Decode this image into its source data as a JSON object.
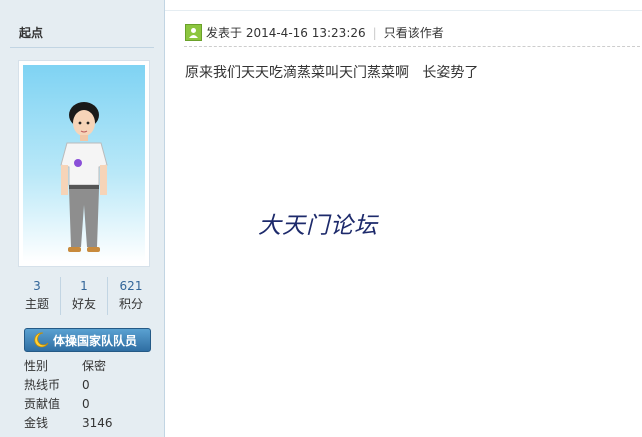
{
  "author": {
    "name": "起点",
    "stats": [
      {
        "value": "3",
        "label": "主题"
      },
      {
        "value": "1",
        "label": "好友"
      },
      {
        "value": "621",
        "label": "积分"
      }
    ],
    "medal": "体操国家队队员",
    "profile": [
      {
        "key": "性别",
        "value": "保密"
      },
      {
        "key": "热线币",
        "value": "0"
      },
      {
        "key": "贡献值",
        "value": "0"
      },
      {
        "key": "金钱",
        "value": "3146"
      }
    ]
  },
  "post": {
    "posted_at": "发表于 2014-4-16 13:23:26",
    "author_only": "只看该作者",
    "content": "原来我们天天吃滴蒸菜叫天门蒸菜啊   长姿势了",
    "watermark": "大天门论坛"
  },
  "colors": {
    "sidebar_bg": "#e5edf2",
    "link": "#336699",
    "medal": "#2f6ea3",
    "watermark": "#1d2a6b"
  }
}
